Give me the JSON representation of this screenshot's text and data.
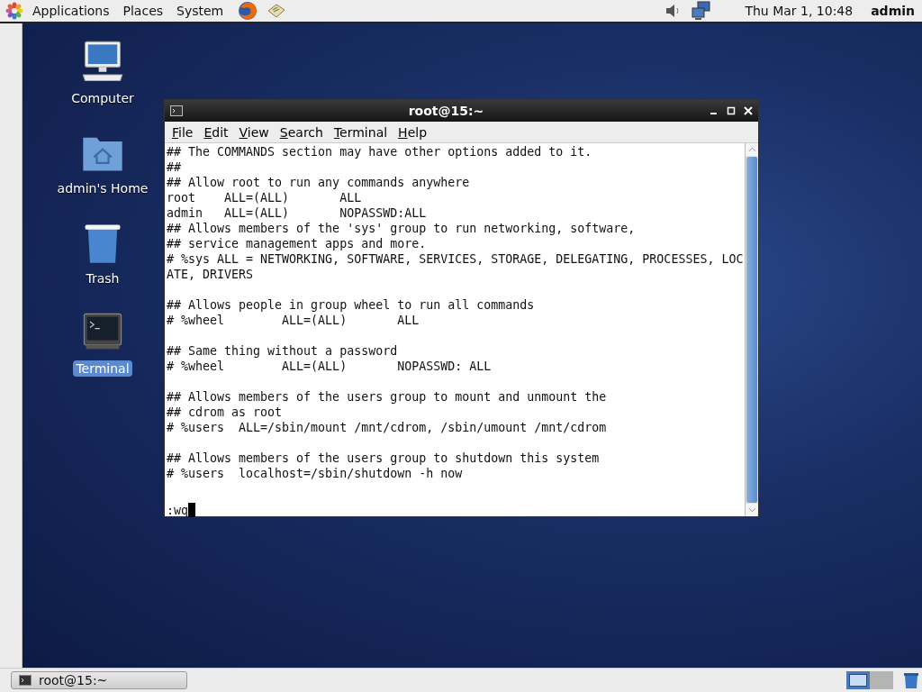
{
  "top_panel": {
    "menus": [
      "Applications",
      "Places",
      "System"
    ],
    "clock": "Thu Mar  1, 10:48",
    "user": "admin"
  },
  "desktop_icons": [
    {
      "kind": "computer",
      "label": "Computer",
      "selected": false
    },
    {
      "kind": "home",
      "label": "admin's Home",
      "selected": false
    },
    {
      "kind": "trash",
      "label": "Trash",
      "selected": false
    },
    {
      "kind": "terminal",
      "label": "Terminal",
      "selected": true
    }
  ],
  "window": {
    "title": "root@15:~",
    "menu": [
      "File",
      "Edit",
      "View",
      "Search",
      "Terminal",
      "Help"
    ],
    "blocks": [
      [
        "## The COMMANDS section may have other options added to it.",
        "##",
        "## Allow root to run any commands anywhere",
        "root    ALL=(ALL)       ALL",
        "admin   ALL=(ALL)       NOPASSWD:ALL",
        "## Allows members of the 'sys' group to run networking, software,",
        "## service management apps and more.",
        "# %sys ALL = NETWORKING, SOFTWARE, SERVICES, STORAGE, DELEGATING, PROCESSES, LOC",
        "ATE, DRIVERS"
      ],
      [
        "## Allows people in group wheel to run all commands",
        "# %wheel        ALL=(ALL)       ALL"
      ],
      [
        "## Same thing without a password",
        "# %wheel        ALL=(ALL)       NOPASSWD: ALL"
      ],
      [
        "## Allows members of the users group to mount and unmount the",
        "## cdrom as root",
        "# %users  ALL=/sbin/mount /mnt/cdrom, /sbin/umount /mnt/cdrom"
      ],
      [
        "## Allows members of the users group to shutdown this system",
        "# %users  localhost=/sbin/shutdown -h now"
      ]
    ],
    "command": ":wq"
  },
  "taskbar": {
    "tasks": [
      {
        "label": "root@15:~",
        "selected": false
      }
    ],
    "workspaces": [
      {
        "selected": true
      },
      {
        "selected": false
      }
    ]
  }
}
